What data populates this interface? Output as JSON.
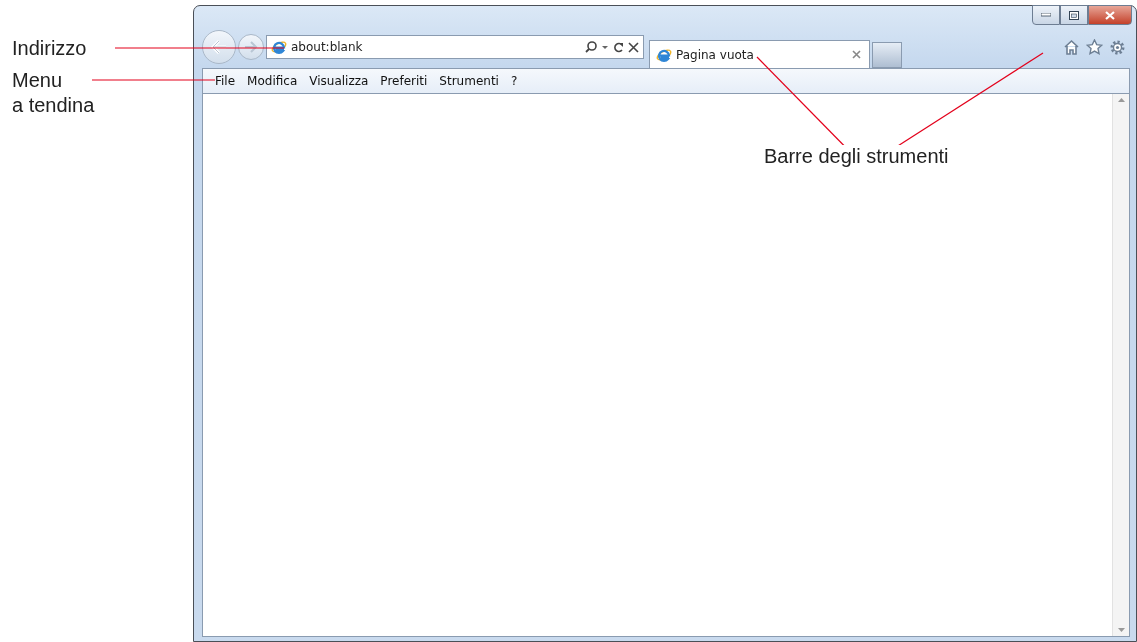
{
  "callouts": {
    "address": "Indirizzo",
    "menu": "Menu\na tendina",
    "toolbars": "Barre degli strumenti"
  },
  "address_bar": {
    "value": "about:blank"
  },
  "tabs": [
    {
      "label": "Pagina vuota",
      "selected": true
    }
  ],
  "menu": [
    "File",
    "Modifica",
    "Visualizza",
    "Preferiti",
    "Strumenti",
    "?"
  ]
}
